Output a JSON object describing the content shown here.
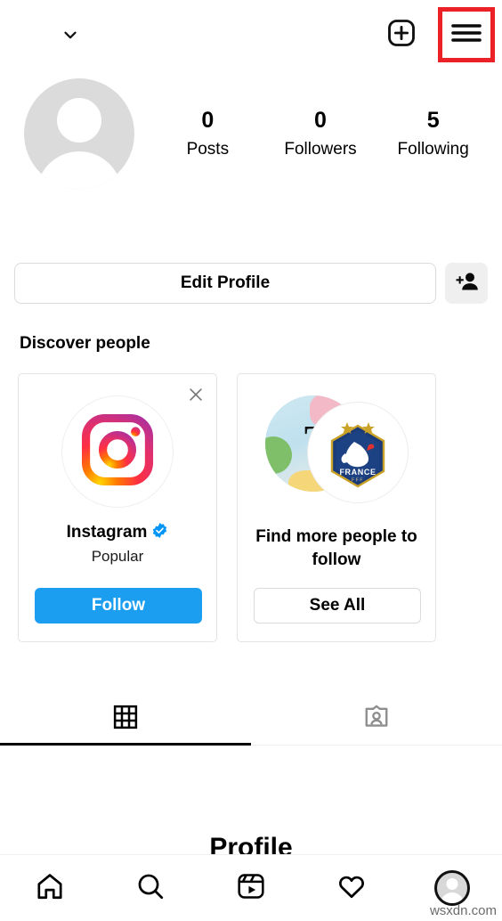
{
  "app": {
    "name": "Instagram",
    "screen": "profile"
  },
  "topbar": {
    "account_name": "",
    "chevron_icon": "chevron-down-icon",
    "new_post_icon": "plus-square-icon",
    "menu_icon": "hamburger-menu-icon",
    "highlight_color": "#ec2027"
  },
  "profile": {
    "avatar_icon": "default-avatar-icon",
    "stats": [
      {
        "value": "0",
        "label": "Posts"
      },
      {
        "value": "0",
        "label": "Followers"
      },
      {
        "value": "5",
        "label": "Following"
      }
    ]
  },
  "actions": {
    "edit_profile_label": "Edit Profile",
    "add_person_icon": "add-person-icon"
  },
  "discover": {
    "title": "Discover people",
    "cards": [
      {
        "type": "suggestion",
        "avatar_icon": "instagram-logo-icon",
        "name": "Instagram",
        "verified": true,
        "verified_icon": "verified-badge-icon",
        "subtitle": "Popular",
        "button_label": "Follow",
        "button_color": "#1b9df0",
        "close_icon": "close-icon"
      },
      {
        "type": "find-more",
        "avatar_back_icon": "photo-avatar-icon",
        "avatar_back_letter": "T",
        "avatar_front_icon": "france-fff-crest-icon",
        "title": "Find more people to follow",
        "button_label": "See All"
      }
    ]
  },
  "tabs": [
    {
      "name": "grid",
      "icon": "grid-icon",
      "active": true
    },
    {
      "name": "tagged",
      "icon": "tagged-person-icon",
      "active": false
    }
  ],
  "ghost": {
    "text": "Profile"
  },
  "bottom_nav": [
    {
      "name": "home",
      "icon": "home-icon",
      "active": false
    },
    {
      "name": "search",
      "icon": "search-icon",
      "active": false
    },
    {
      "name": "reels",
      "icon": "reels-icon",
      "active": false
    },
    {
      "name": "activity",
      "icon": "heart-icon",
      "active": false
    },
    {
      "name": "profile",
      "icon": "profile-avatar-icon",
      "active": true
    }
  ],
  "watermark": "wsxdn.com"
}
